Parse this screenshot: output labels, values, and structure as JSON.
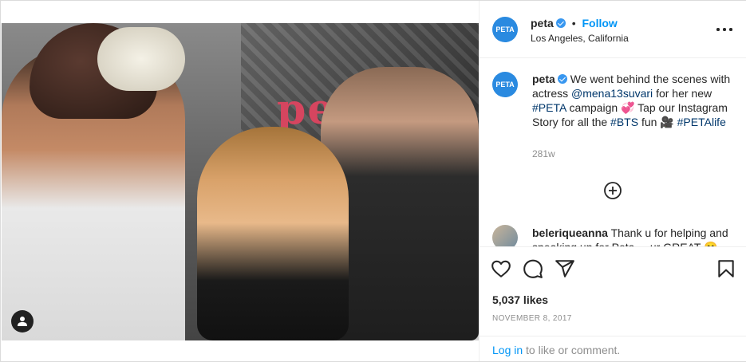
{
  "post": {
    "header": {
      "avatar_text": "PETA",
      "username": "peta",
      "separator": "•",
      "follow_label": "Follow",
      "location": "Los Angeles, California"
    },
    "caption": {
      "avatar_text": "PETA",
      "username": "peta",
      "text_1": "We went behind the scenes with actress",
      "mention": "@mena13suvari",
      "text_2": "for her new",
      "hashtag_1": "#PETA",
      "text_3": "campaign 💞 Tap our Instagram Story for all the",
      "hashtag_2": "#BTS",
      "text_4": "fun 🎥",
      "hashtag_3": "#PETAlife",
      "time": "281w"
    },
    "comment": {
      "username": "beleriqueanna",
      "text": "Thank u for helping and speaking up for Peta.... ur GREAT 😊"
    },
    "likes": "5,037 likes",
    "date": "NOVEMBER 8, 2017",
    "login": {
      "link": "Log in",
      "text": "to like or comment."
    }
  },
  "icons": {
    "user_tag": "person-icon",
    "more": "more-options-icon",
    "load_more": "plus-circle-icon",
    "like": "heart-icon",
    "comment": "comment-icon",
    "share": "share-icon",
    "save": "bookmark-icon"
  }
}
